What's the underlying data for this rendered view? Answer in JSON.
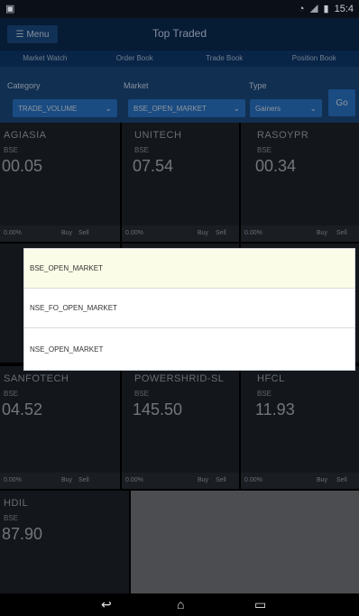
{
  "status_bar": {
    "right_text": "15:4"
  },
  "action_bar": {
    "menu_label": "Menu",
    "title": "Top Traded"
  },
  "tabs": [
    {
      "label": "Market Watch"
    },
    {
      "label": "Order Book"
    },
    {
      "label": "Trade Book"
    },
    {
      "label": "Position Book"
    }
  ],
  "filters": {
    "category_label": "Category",
    "category_value": "TRADE_VOLUME",
    "market_label": "Market",
    "market_value": "BSE_OPEN_MARKET",
    "type_label": "Type",
    "type_value": "Gainers",
    "go_label": "Go"
  },
  "tiles": [
    {
      "symbol": "AGIASIA",
      "exchange": "BSE",
      "price": "00.05",
      "pct": "0.00%",
      "buy": "Buy",
      "sell": "Sell"
    },
    {
      "symbol": "UNITECH",
      "exchange": "BSE",
      "price": "07.54",
      "pct": "0.00%",
      "buy": "Buy",
      "sell": "Sell"
    },
    {
      "symbol": "RASOYPR",
      "exchange": "BSE",
      "price": "00.34",
      "pct": "0.00%",
      "buy": "Buy",
      "sell": "Sell"
    },
    {
      "symbol": "SANFOTECH",
      "exchange": "BSE",
      "price": "04.52",
      "pct": "0.00%",
      "buy": "Buy",
      "sell": "Sell"
    },
    {
      "symbol": "POWERSHRID-SL",
      "exchange": "BSE",
      "price": "145.50",
      "pct": "0.00%",
      "buy": "Buy",
      "sell": "Sell"
    },
    {
      "symbol": "HFCL",
      "exchange": "BSE",
      "price": "11.93",
      "pct": "0.00%",
      "buy": "Buy",
      "sell": "Sell"
    },
    {
      "symbol": "HDIL",
      "exchange": "BSE",
      "price": "87.90"
    }
  ],
  "dropdown": {
    "options": [
      {
        "label": "BSE_OPEN_MARKET",
        "selected": true
      },
      {
        "label": "NSE_FO_OPEN_MARKET",
        "selected": false
      },
      {
        "label": "NSE_OPEN_MARKET",
        "selected": false
      }
    ]
  },
  "colors": {
    "action_bar": "#0b2c55",
    "filter_bg": "#1c4c83",
    "accent": "#2a7ad0",
    "tile_bg": "#1f242c"
  }
}
